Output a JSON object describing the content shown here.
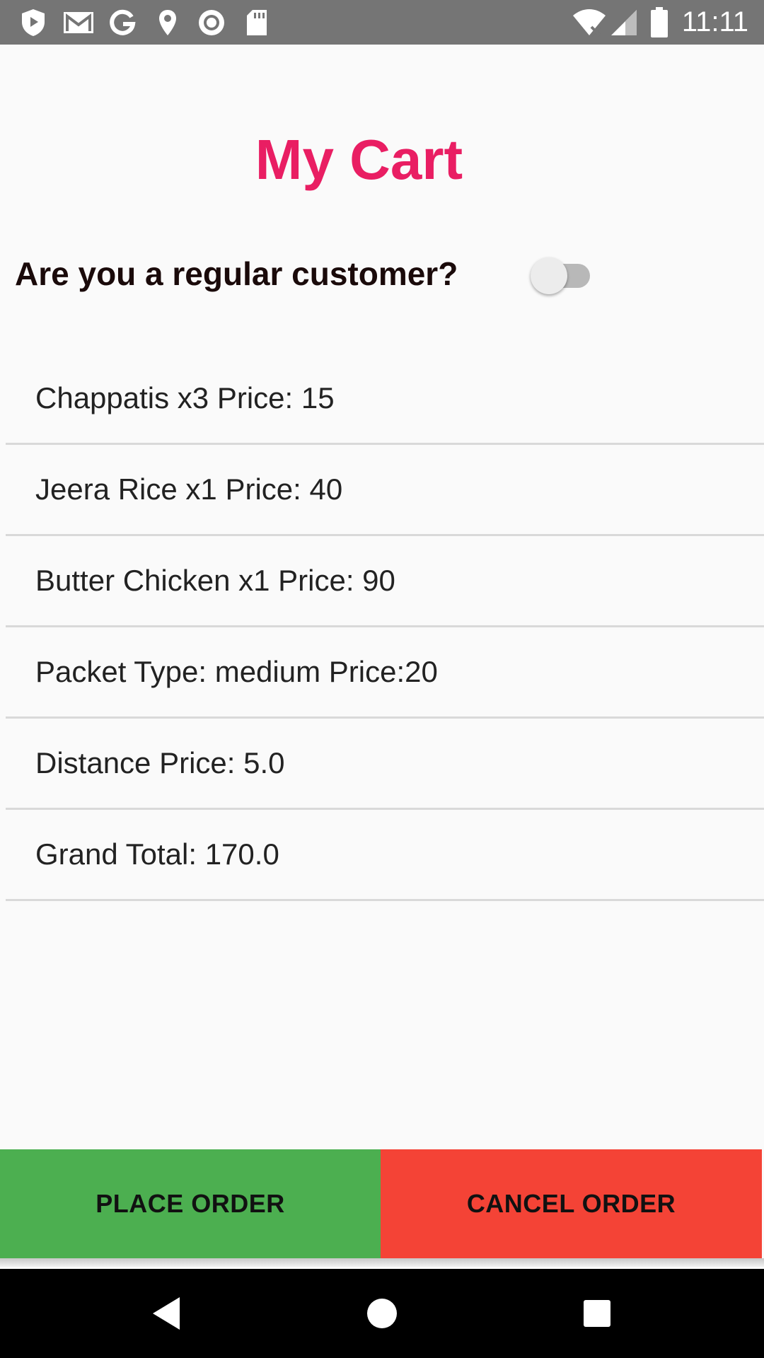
{
  "status_bar": {
    "time": "11:11",
    "icons_left": [
      "shield-icon",
      "gmail-icon",
      "google-icon",
      "location-icon",
      "record-icon",
      "sd-card-icon"
    ],
    "icons_right": [
      "wifi-icon",
      "signal-icon",
      "battery-icon"
    ]
  },
  "page": {
    "title": "My Cart",
    "regular_customer_question": "Are you a regular customer?",
    "regular_customer_toggle_on": false
  },
  "cart": {
    "items": [
      {
        "text": "Chappatis x3  Price: 15"
      },
      {
        "text": "Jeera Rice x1  Price: 40"
      },
      {
        "text": "Butter Chicken x1  Price: 90"
      },
      {
        "text": "Packet Type: medium Price:20"
      },
      {
        "text": "Distance Price: 5.0"
      },
      {
        "text": "Grand Total: 170.0"
      }
    ]
  },
  "actions": {
    "place_order_label": "PLACE ORDER",
    "cancel_order_label": "CANCEL ORDER"
  },
  "colors": {
    "title": "#e91e63",
    "place_order": "#4caf50",
    "cancel_order": "#f44336",
    "status_bar": "#757575"
  },
  "nav_bar": {
    "buttons": [
      "back-icon",
      "home-icon",
      "recents-icon"
    ]
  }
}
